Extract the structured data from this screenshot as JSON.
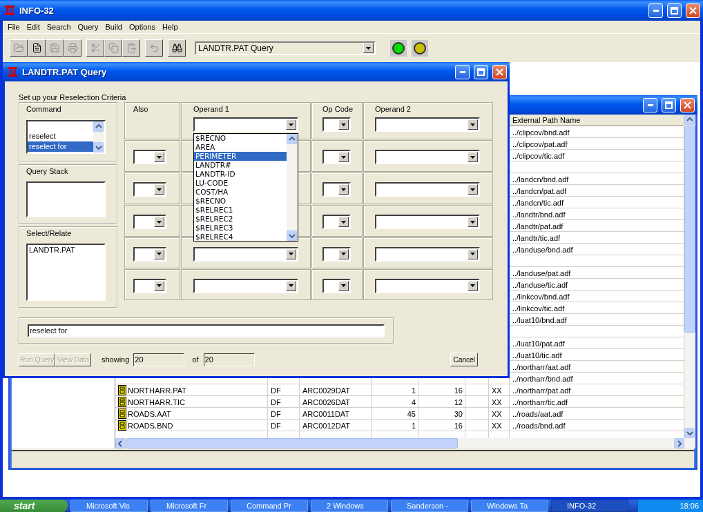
{
  "window": {
    "title": "INFO-32"
  },
  "menu": [
    "File",
    "Edit",
    "Search",
    "Query",
    "Build",
    "Options",
    "Help"
  ],
  "toolbar": {
    "groups": [
      [
        {
          "kind": "open",
          "disabled": true
        },
        {
          "kind": "new",
          "disabled": false
        },
        {
          "kind": "save",
          "disabled": true
        },
        {
          "kind": "print",
          "disabled": true
        }
      ],
      [
        {
          "kind": "cut",
          "disabled": true
        },
        {
          "kind": "copy",
          "disabled": true
        },
        {
          "kind": "paste",
          "disabled": true
        }
      ],
      [
        {
          "kind": "undo",
          "disabled": true
        }
      ],
      [
        {
          "kind": "find",
          "disabled": false
        }
      ]
    ],
    "window_select": {
      "value": "LANDTR.PAT Query"
    },
    "lights": [
      {
        "color": "#00dd00"
      },
      {
        "color": "#c8c000"
      }
    ]
  },
  "table_window": {
    "path_column": "External Path Name",
    "rows": [
      {
        "path": "../clipcov/bnd.adf"
      },
      {
        "path": "../clipcov/pat.adf"
      },
      {
        "path": "../clipcov/tic.adf"
      },
      {},
      {
        "path": "../landcn/bnd.adf"
      },
      {
        "path": "../landcn/pat.adf"
      },
      {
        "path": "../landcn/tic.adf"
      },
      {
        "path": "../landtr/bnd.adf"
      },
      {
        "path": "../landtr/pat.adf"
      },
      {
        "path": "../landtr/tic.adf"
      },
      {
        "path": "../landuse/bnd.adf"
      },
      {},
      {
        "path": "../landuse/pat.adf"
      },
      {
        "path": "../landuse/tic.adf"
      },
      {
        "path": "../linkcov/bnd.adf"
      },
      {
        "path": "../linkcov/tic.adf"
      },
      {
        "path": "../luat10/bnd.adf"
      },
      {},
      {
        "path": "../luat10/pat.adf"
      },
      {
        "path": "../luat10/tic.adf"
      },
      {
        "path": "../northarr/aat.adf"
      },
      {
        "path": "../northarr/bnd.adf"
      },
      {
        "name": "NORTHARR.PAT",
        "column_2": "DF",
        "column_3": "ARC0029DAT",
        "column_4": "1",
        "column_5": "16",
        "column_7": "XX",
        "path": "../northarr/pat.adf"
      },
      {
        "name": "NORTHARR.TIC",
        "column_2": "DF",
        "column_3": "ARC0026DAT",
        "column_4": "4",
        "column_5": "12",
        "column_7": "XX",
        "path": "../northarr/tic.adf"
      },
      {
        "name": "ROADS.AAT",
        "column_2": "DF",
        "column_3": "ARC0011DAT",
        "column_4": "45",
        "column_5": "30",
        "column_7": "XX",
        "path": "../roads/aat.adf"
      },
      {
        "name": "ROADS.BND",
        "column_2": "DF",
        "column_3": "ARC0012DAT",
        "column_4": "1",
        "column_5": "16",
        "column_7": "XX",
        "path": "../roads/bnd.adf"
      }
    ]
  },
  "dialog": {
    "title": "LANDTR.PAT Query",
    "heading": "Set up your Reselection Criteria",
    "command": {
      "label": "Command",
      "items": [
        {
          "label": "reselect",
          "selected": false
        },
        {
          "label": "reselect for",
          "selected": true
        }
      ]
    },
    "query_stack": {
      "label": "Query Stack"
    },
    "select_relate": {
      "label": "Select/Relate",
      "items": [
        "LANDTR.PAT"
      ]
    },
    "grid_columns": [
      "Also",
      "Operand 1",
      "Op Code",
      "Operand 2"
    ],
    "grid_rows": [
      {
        "kind": "first"
      },
      {
        "kind": "next"
      },
      {
        "kind": "next"
      },
      {
        "kind": "next"
      },
      {
        "kind": "next"
      },
      {
        "kind": "next"
      }
    ],
    "operand_1_list": {
      "expanded": true,
      "options": [
        {
          "label": "$RECNO",
          "selected": false
        },
        {
          "label": "AREA",
          "selected": false
        },
        {
          "label": "PERIMETER",
          "selected": true
        },
        {
          "label": "LANDTR#",
          "selected": false
        },
        {
          "label": "LANDTR-ID",
          "selected": false
        },
        {
          "label": "LU-CODE",
          "selected": false
        },
        {
          "label": "COST/HA",
          "selected": false
        },
        {
          "label": "$RECNO",
          "selected": false
        },
        {
          "label": "$RELREC1",
          "selected": false
        },
        {
          "label": "$RELREC2",
          "selected": false
        },
        {
          "label": "$RELREC3",
          "selected": false
        },
        {
          "label": "$RELREC4",
          "selected": false
        }
      ]
    },
    "command_line": {
      "value": "reselect for"
    },
    "buttons": [
      {
        "label": "Run Query",
        "disabled": true
      },
      {
        "label": "View Data",
        "disabled": true
      }
    ],
    "showing": {
      "label": "showing",
      "value": "20"
    },
    "total": {
      "label": "of",
      "value": "20"
    },
    "cancel": "Cancel"
  },
  "taskbar": {
    "start": "start",
    "items": [
      {
        "label": "Microsoft Vis",
        "selected": false
      },
      {
        "label": "Microsoft Fr",
        "selected": false
      },
      {
        "label": "Command Pr",
        "selected": false
      },
      {
        "label": "2 Windows",
        "selected": false
      },
      {
        "label": "Sanderson -",
        "selected": false
      },
      {
        "label": "Windows Ta",
        "selected": false
      },
      {
        "label": "INFO-32",
        "selected": true
      }
    ],
    "clock": "18:06"
  }
}
